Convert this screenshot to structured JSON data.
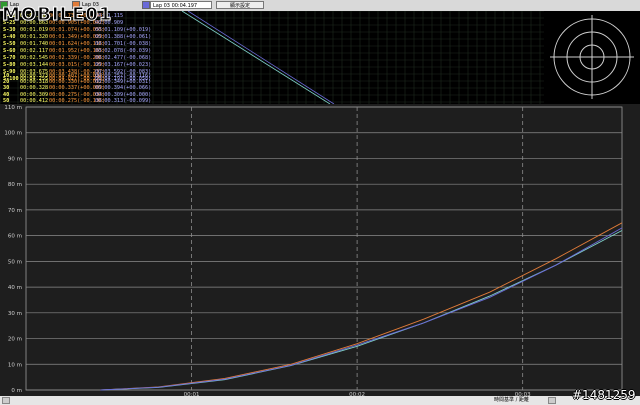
{
  "app": {
    "logo_text": "MOBILE01",
    "watermark": "#1481259"
  },
  "toolbar": {
    "item1_label": "Lap",
    "item2_label": "Lap 03",
    "lap_value": "Lap 03    00:04.197",
    "button_label": "顯示設定"
  },
  "lap_panel": {
    "split_rows": [
      {
        "label": "S-20",
        "t": "00:00.693",
        "d1": "00:00.737(+00.044)",
        "d2": "00:01.115"
      },
      {
        "label": "S-25",
        "t": "00:00.863",
        "d1": "00:00.905(+00.042)",
        "d2": "00:00.909"
      },
      {
        "label": "S-30",
        "t": "00:01.019",
        "d1": "00:01.074(+00.055)",
        "d2": "00:01.109(+00.019)"
      },
      {
        "label": "S-40",
        "t": "00:01.320",
        "d1": "00:01.349(+00.029)",
        "d2": "00:01.388(+00.061)"
      },
      {
        "label": "S-50",
        "t": "00:01.740",
        "d1": "00:01.624(+00.116)",
        "d2": "00:01.701(-00.038)"
      },
      {
        "label": "S-60",
        "t": "00:02.117",
        "d1": "00:01.952(+00.165)",
        "d2": "00:02.078(-00.039)"
      },
      {
        "label": "S-70",
        "t": "00:02.545",
        "d1": "00:02.339(-00.206)",
        "d2": "00:02.477(-00.068)"
      },
      {
        "label": "S-80",
        "t": "00:03.144",
        "d1": "00:03.015(-00.129)",
        "d2": "00:03.167(+00.023)"
      },
      {
        "label": "S-90",
        "t": "00:03.675",
        "d1": "00:03.438(-00.237)",
        "d2": "00:03.592(-00.083)"
      },
      {
        "label": "S-100",
        "t": "00:04.255",
        "d1": "00:04.027(-00.228)",
        "d2": "00:04.197(-00.058)"
      }
    ],
    "distance_rows": [
      {
        "label": "10",
        "t": "00:00.373",
        "d1": "00:00.407(+00.034)",
        "d2": "00:00.257(-00.116)"
      },
      {
        "label": "20",
        "t": "00:00.318",
        "d1": "00:00.330(+00.012)",
        "d2": "00:00.349(+00.031)"
      },
      {
        "label": "30",
        "t": "00:00.328",
        "d1": "00:00.337(+00.009)",
        "d2": "00:00.394(+00.066)"
      },
      {
        "label": "40",
        "t": "00:00.309",
        "d1": "00:00.275(-00.034)",
        "d2": "00:00.309(+00.000)"
      },
      {
        "label": "50",
        "t": "00:00.412",
        "d1": "00:00.275(-00.136)",
        "d2": "00:00.313(-00.099)"
      }
    ]
  },
  "colors": {
    "series_orange": "#e07b39",
    "series_cyan": "#7fd0c8",
    "series_blue": "#6a6ad8",
    "text_yellow": "#ffff66",
    "text_orange": "#ff9a3c",
    "text_blue": "#a9a9ff"
  },
  "chart_data": {
    "type": "line",
    "ylim": [
      0,
      110
    ],
    "xlim": [
      0,
      3.6
    ],
    "y_ticks": [
      0,
      10,
      20,
      30,
      40,
      50,
      60,
      70,
      80,
      90,
      100,
      110
    ],
    "y_tick_labels": [
      "0 m",
      "10 m",
      "20 m",
      "30 m",
      "40 m",
      "50 m",
      "60 m",
      "70 m",
      "80 m",
      "90 m",
      "100 m",
      "110 m"
    ],
    "x_ticks": [
      1,
      2,
      3
    ],
    "x_tick_labels": [
      "00:01",
      "00:02",
      "00:03"
    ],
    "series": [
      {
        "color": "#e07b39",
        "x": [
          0.45,
          0.8,
          1.2,
          1.6,
          2.0,
          2.4,
          2.8,
          3.2,
          3.6
        ],
        "y": [
          0,
          1.2,
          4.5,
          10,
          18,
          27.5,
          38,
          51,
          65
        ]
      },
      {
        "color": "#7fd0c8",
        "x": [
          0.45,
          0.8,
          1.2,
          1.6,
          2.0,
          2.4,
          2.8,
          3.2,
          3.6
        ],
        "y": [
          0,
          1.0,
          4.0,
          9.5,
          17,
          26,
          36.5,
          48.5,
          62
        ]
      },
      {
        "color": "#6a6ad8",
        "x": [
          0.45,
          0.8,
          1.2,
          1.6,
          2.0,
          2.4,
          2.8,
          3.2,
          3.6
        ],
        "y": [
          0,
          1.1,
          4.2,
          9.6,
          17.5,
          26,
          36,
          48.5,
          63
        ]
      }
    ]
  }
}
